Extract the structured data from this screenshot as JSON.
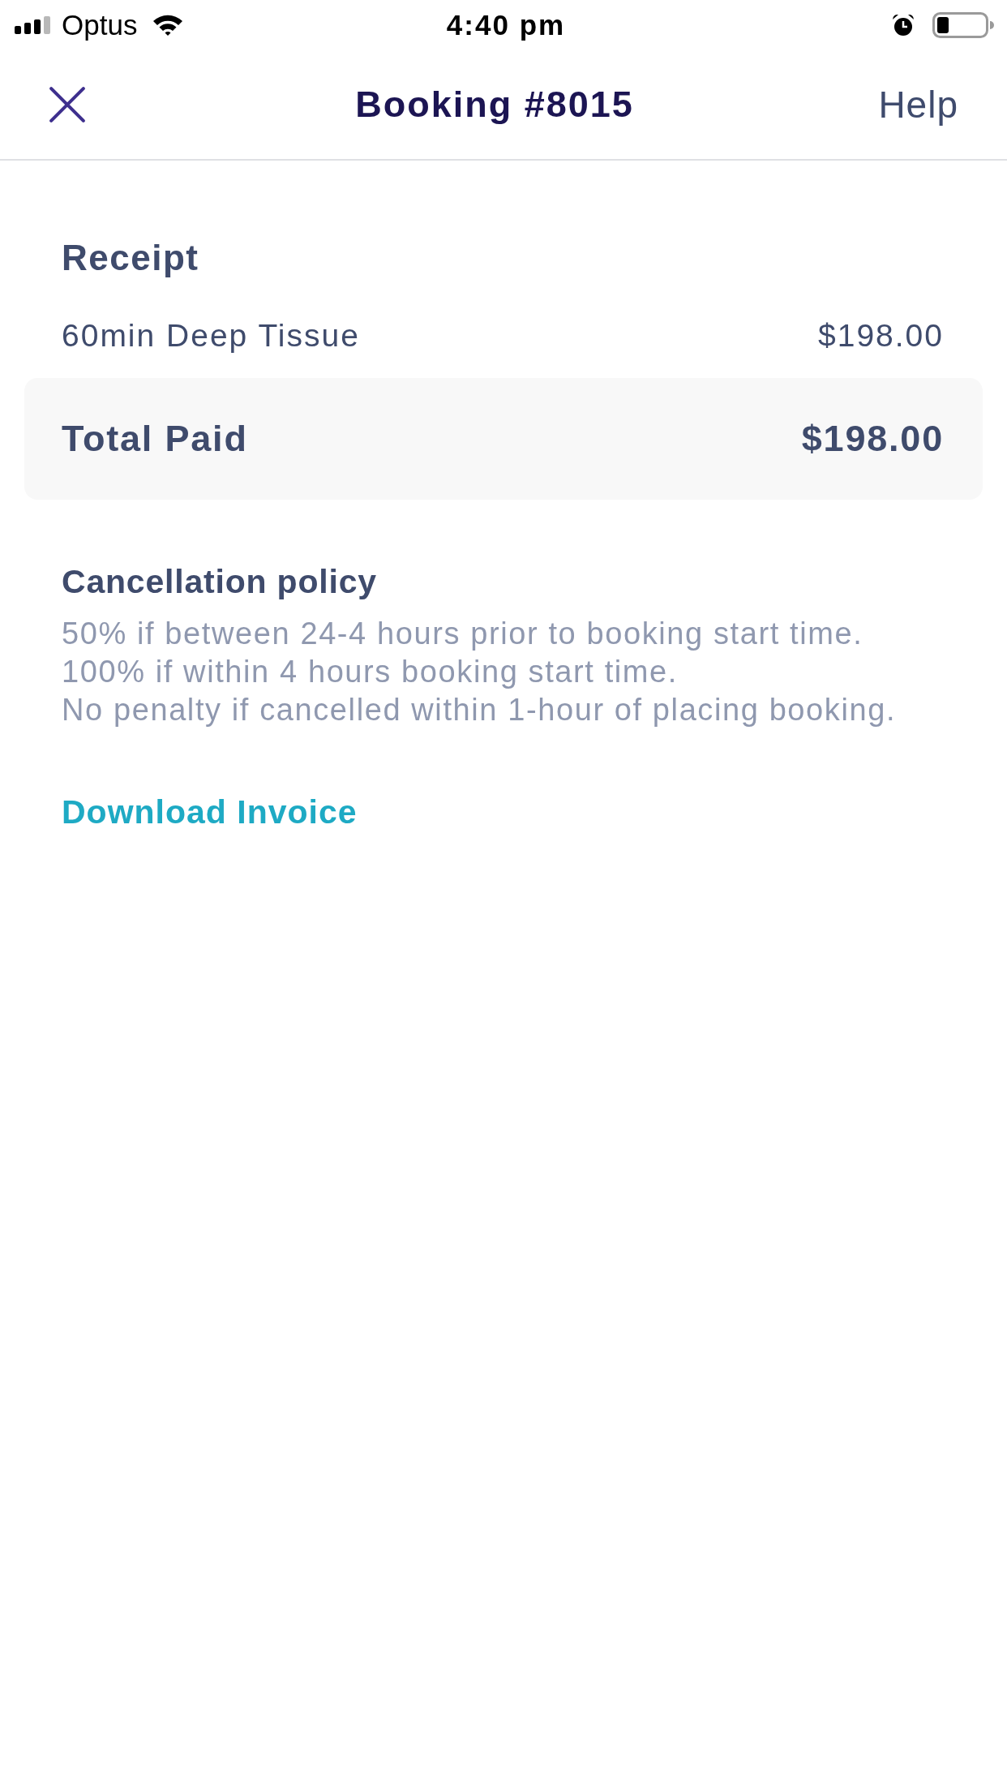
{
  "status_bar": {
    "carrier": "Optus",
    "time": "4:40 pm"
  },
  "nav": {
    "title": "Booking #8015",
    "help": "Help"
  },
  "receipt": {
    "title": "Receipt",
    "items": [
      {
        "name": "60min Deep Tissue",
        "price": "$198.00"
      }
    ],
    "total": {
      "label": "Total Paid",
      "amount": "$198.00"
    }
  },
  "cancellation_policy": {
    "title": "Cancellation policy",
    "lines": [
      "50% if between 24-4 hours prior to booking start time.",
      "100% if within 4 hours booking start time.",
      "No penalty if cancelled within 1-hour of placing booking."
    ]
  },
  "download_link": "Download Invoice"
}
